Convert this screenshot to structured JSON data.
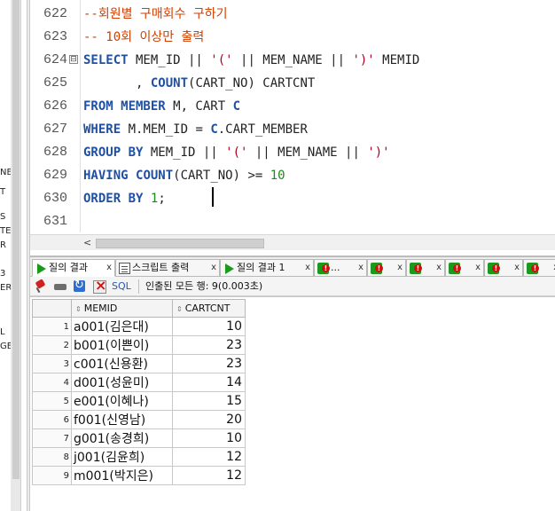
{
  "left_panel": {
    "fragments": [
      "NE",
      "T",
      "S",
      "TE",
      "R",
      "3",
      "ER",
      "L",
      "GE"
    ]
  },
  "editor": {
    "lines": [
      {
        "num": "622",
        "tokens": [
          {
            "t": "--회원별 구매회수 구하기",
            "c": "cmt"
          }
        ]
      },
      {
        "num": "623",
        "tokens": [
          {
            "t": "-- 10회 이상만 출력",
            "c": "cmt"
          }
        ]
      },
      {
        "num": "624",
        "fold": "⊟",
        "tokens": [
          {
            "t": "SELECT",
            "c": "kw"
          },
          {
            "t": " MEM_ID || ",
            "c": "plain"
          },
          {
            "t": "'('",
            "c": "str"
          },
          {
            "t": " || MEM_NAME || ",
            "c": "plain"
          },
          {
            "t": "')'",
            "c": "str"
          },
          {
            "t": " MEMID",
            "c": "plain"
          }
        ]
      },
      {
        "num": "625",
        "tokens": [
          {
            "t": "       , ",
            "c": "plain"
          },
          {
            "t": "COUNT",
            "c": "kw"
          },
          {
            "t": "(CART_NO) CARTCNT",
            "c": "plain"
          }
        ]
      },
      {
        "num": "626",
        "tokens": [
          {
            "t": "FROM MEMBER",
            "c": "kw"
          },
          {
            "t": " M, CART ",
            "c": "plain"
          },
          {
            "t": "C",
            "c": "kw"
          }
        ]
      },
      {
        "num": "627",
        "tokens": [
          {
            "t": "WHERE",
            "c": "kw"
          },
          {
            "t": " M.MEM_ID = ",
            "c": "plain"
          },
          {
            "t": "C",
            "c": "kw"
          },
          {
            "t": ".CART_MEMBER",
            "c": "plain"
          }
        ]
      },
      {
        "num": "628",
        "tokens": [
          {
            "t": "GROUP BY",
            "c": "kw"
          },
          {
            "t": " MEM_ID || ",
            "c": "plain"
          },
          {
            "t": "'('",
            "c": "str"
          },
          {
            "t": " || MEM_NAME || ",
            "c": "plain"
          },
          {
            "t": "')'",
            "c": "str"
          }
        ]
      },
      {
        "num": "629",
        "tokens": [
          {
            "t": "HAVING",
            "c": "kw"
          },
          {
            "t": " ",
            "c": "plain"
          },
          {
            "t": "COUNT",
            "c": "kw"
          },
          {
            "t": "(CART_NO) >= ",
            "c": "plain"
          },
          {
            "t": "10",
            "c": "num"
          }
        ]
      },
      {
        "num": "630",
        "tokens": [
          {
            "t": "ORDER BY",
            "c": "kw"
          },
          {
            "t": " ",
            "c": "plain"
          },
          {
            "t": "1",
            "c": "num"
          },
          {
            "t": ";",
            "c": "plain"
          }
        ]
      },
      {
        "num": "631",
        "tokens": []
      }
    ],
    "hscroll_arrow": "<"
  },
  "tabs": [
    {
      "label": "질의 결과",
      "icon": "run",
      "close": "x",
      "active": true
    },
    {
      "label": "스크립트 출력",
      "icon": "script",
      "close": "x",
      "active": false
    },
    {
      "label": "질의 결과 1",
      "icon": "run",
      "close": "x",
      "active": false
    },
    {
      "label": "...",
      "icon": "err",
      "close": "x",
      "active": false
    },
    {
      "label": "",
      "icon": "err",
      "close": "x",
      "active": false
    },
    {
      "label": "",
      "icon": "err",
      "close": "x",
      "active": false
    },
    {
      "label": "",
      "icon": "err",
      "close": "x",
      "active": false
    },
    {
      "label": "",
      "icon": "err",
      "close": "x",
      "active": false
    },
    {
      "label": "",
      "icon": "err",
      "close": "x",
      "active": false
    }
  ],
  "toolbar": {
    "sql_label": "SQL",
    "fetch_status": "인출된 모든 행: 9(0.003초)"
  },
  "grid": {
    "columns": [
      {
        "label": "MEMID",
        "sort_icon": "⇕"
      },
      {
        "label": "CARTCNT",
        "sort_icon": "⇕"
      }
    ],
    "rows": [
      {
        "n": "1",
        "memid": "a001(김은대)",
        "cnt": "10"
      },
      {
        "n": "2",
        "memid": "b001(이쁜이)",
        "cnt": "23"
      },
      {
        "n": "3",
        "memid": "c001(신용환)",
        "cnt": "23"
      },
      {
        "n": "4",
        "memid": "d001(성윤미)",
        "cnt": "14"
      },
      {
        "n": "5",
        "memid": "e001(이혜나)",
        "cnt": "15"
      },
      {
        "n": "6",
        "memid": "f001(신영남)",
        "cnt": "20"
      },
      {
        "n": "7",
        "memid": "g001(송경희)",
        "cnt": "10"
      },
      {
        "n": "8",
        "memid": "j001(김윤희)",
        "cnt": "12"
      },
      {
        "n": "9",
        "memid": "m001(박지은)",
        "cnt": "12"
      }
    ]
  }
}
